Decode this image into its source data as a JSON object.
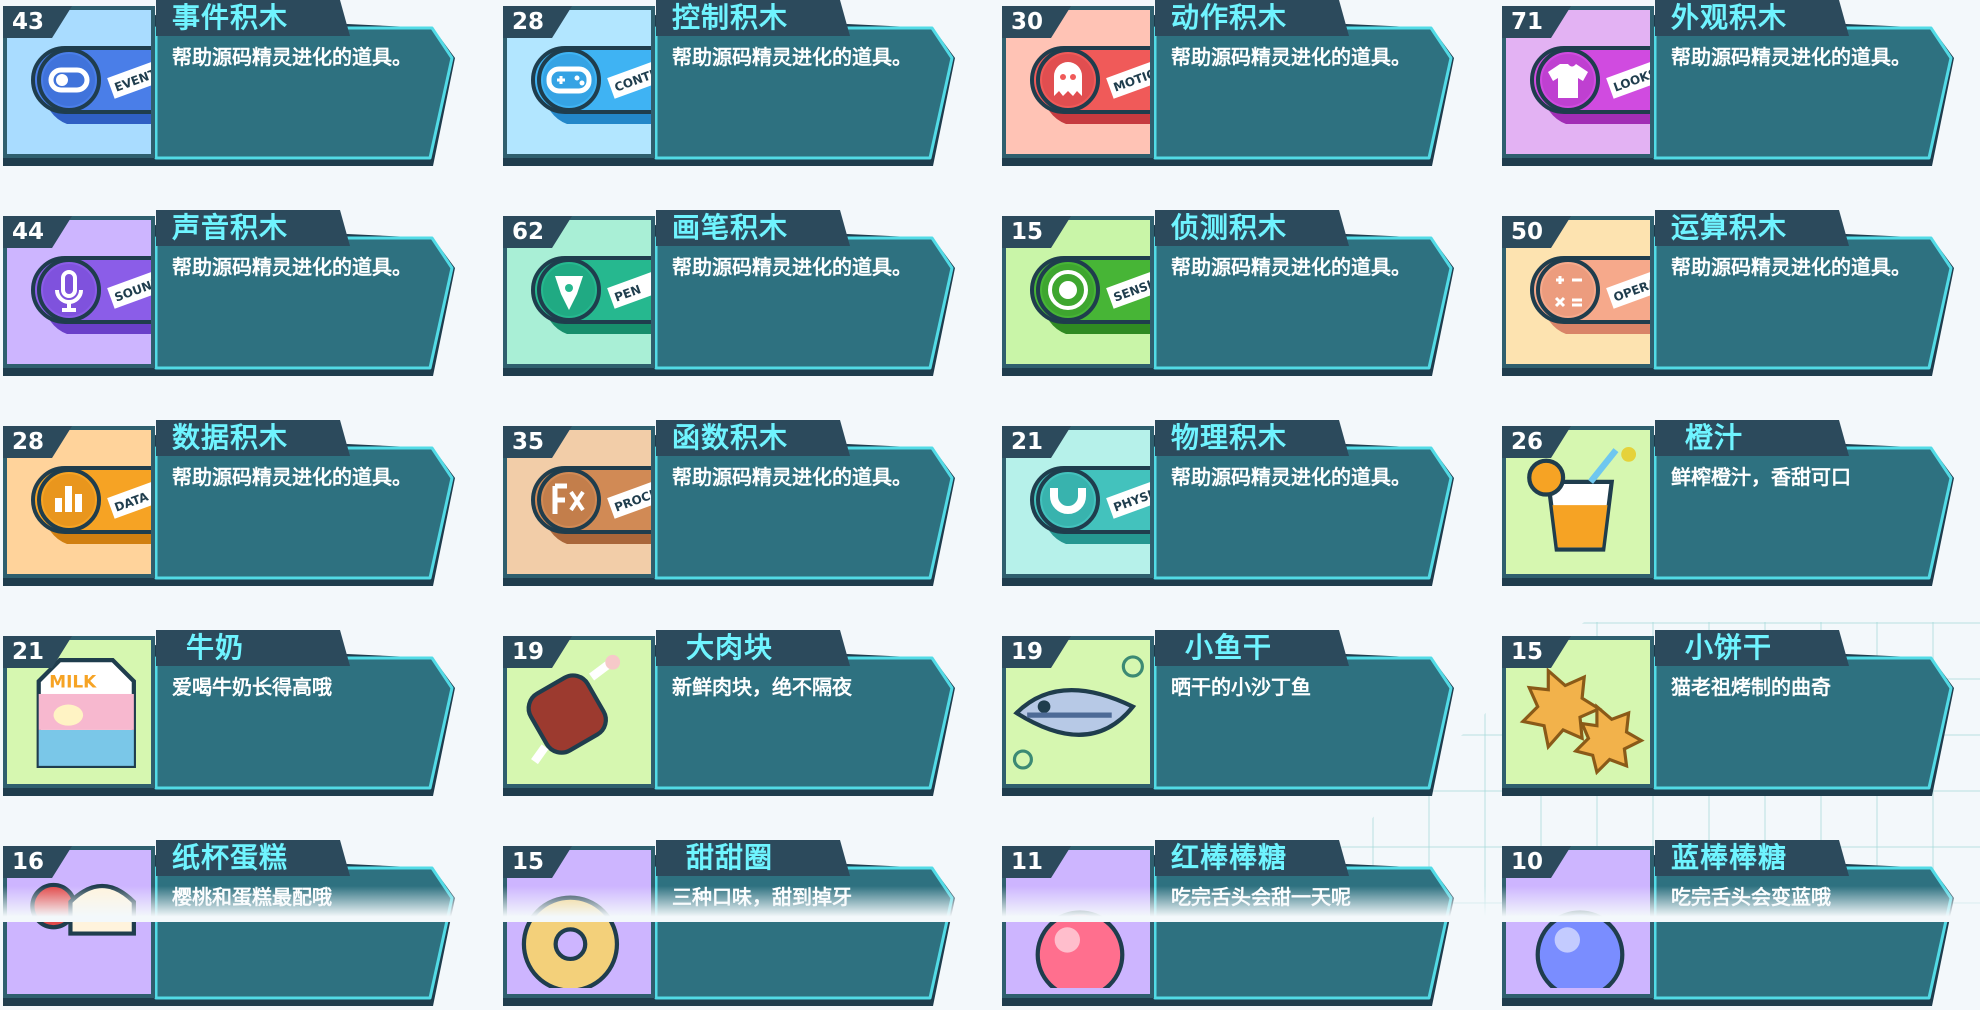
{
  "items": [
    {
      "count": "43",
      "name": "事件积木",
      "desc": "帮助源码精灵进化的道具。",
      "kind": "block",
      "badge": "EVENTS",
      "icon": "toggle-icon",
      "bg": "#a9dcff",
      "color": "#4a7ee8",
      "dark": "#2f5fc4"
    },
    {
      "count": "28",
      "name": "控制积木",
      "desc": "帮助源码精灵进化的道具。",
      "kind": "block",
      "badge": "CONTROL",
      "icon": "gamepad-icon",
      "bg": "#b2e6ff",
      "color": "#3fb3f3",
      "dark": "#2387c9"
    },
    {
      "count": "30",
      "name": "动作积木",
      "desc": "帮助源码精灵进化的道具。",
      "kind": "block",
      "badge": "MOTION",
      "icon": "ghost-icon",
      "bg": "#ffc3b5",
      "color": "#f05a59",
      "dark": "#c63a3f"
    },
    {
      "count": "71",
      "name": "外观积木",
      "desc": "帮助源码精灵进化的道具。",
      "kind": "block",
      "badge": "LOOKS",
      "icon": "shirt-icon",
      "bg": "#e3b2f3",
      "color": "#d04be0",
      "dark": "#a12db5"
    },
    {
      "count": "44",
      "name": "声音积木",
      "desc": "帮助源码精灵进化的道具。",
      "kind": "block",
      "badge": "SOUND",
      "icon": "microphone-icon",
      "bg": "#cdb5ff",
      "color": "#8b5de8",
      "dark": "#6a3fc9"
    },
    {
      "count": "62",
      "name": "画笔积木",
      "desc": "帮助源码精灵进化的道具。",
      "kind": "block",
      "badge": "PEN",
      "icon": "pen-icon",
      "bg": "#a9efd6",
      "color": "#26b88f",
      "dark": "#178e6c"
    },
    {
      "count": "15",
      "name": "侦测积木",
      "desc": "帮助源码精灵进化的道具。",
      "kind": "block",
      "badge": "SENSING",
      "icon": "target-icon",
      "bg": "#c9f5a8",
      "color": "#47b536",
      "dark": "#2f8a22"
    },
    {
      "count": "50",
      "name": "运算积木",
      "desc": "帮助源码精灵进化的道具。",
      "kind": "block",
      "badge": "OPERATOR",
      "icon": "calculator-icon",
      "bg": "#fde3b0",
      "color": "#f6a98b",
      "dark": "#d98468"
    },
    {
      "count": "28",
      "name": "数据积木",
      "desc": "帮助源码精灵进化的道具。",
      "kind": "block",
      "badge": "DATA",
      "icon": "bar-chart-icon",
      "bg": "#ffd39b",
      "color": "#f6a324",
      "dark": "#d17f10"
    },
    {
      "count": "35",
      "name": "函数积木",
      "desc": "帮助源码精灵进化的道具。",
      "kind": "block",
      "badge": "PROCEDURE",
      "icon": "function-icon",
      "bg": "#f2cda8",
      "color": "#d18a55",
      "dark": "#a9663a"
    },
    {
      "count": "21",
      "name": "物理积木",
      "desc": "帮助源码精灵进化的道具。",
      "kind": "block",
      "badge": "PHYSICS",
      "icon": "magnet-icon",
      "bg": "#b6f1ea",
      "color": "#43c2bd",
      "dark": "#259791"
    },
    {
      "count": "26",
      "name": "橙汁",
      "desc": "鲜榨橙汁，香甜可口",
      "kind": "food",
      "icon": "orange-juice-icon",
      "bg": "#d6f7b0",
      "color": "#f6a324",
      "dark": "#d17f10"
    },
    {
      "count": "21",
      "name": "牛奶",
      "desc": "爱喝牛奶长得高哦",
      "kind": "food",
      "icon": "milk-carton-icon",
      "bg": "#d6f7b0",
      "color": "#ffffff",
      "dark": "#7ac7e8"
    },
    {
      "count": "19",
      "name": "大肉块",
      "desc": "新鲜肉块，绝不隔夜",
      "kind": "food",
      "icon": "meat-icon",
      "bg": "#d6f7b0",
      "color": "#9c3a2f",
      "dark": "#6c2219"
    },
    {
      "count": "19",
      "name": "小鱼干",
      "desc": "晒干的小沙丁鱼",
      "kind": "food",
      "icon": "fish-icon",
      "bg": "#d6f7b0",
      "color": "#b7c9e6",
      "dark": "#4d6a96"
    },
    {
      "count": "15",
      "name": "小饼干",
      "desc": "猫老祖烤制的曲奇",
      "kind": "food",
      "icon": "cookie-icon",
      "bg": "#d6f7b0",
      "color": "#f2b24b",
      "dark": "#c77e1b"
    },
    {
      "count": "16",
      "name": "纸杯蛋糕",
      "desc": "樱桃和蛋糕最配哦",
      "kind": "food",
      "icon": "cupcake-icon",
      "bg": "#cdb5ff",
      "color": "#e24a4a",
      "dark": "#9c2a2a"
    },
    {
      "count": "15",
      "name": "甜甜圈",
      "desc": "三种口味，甜到掉牙",
      "kind": "food",
      "icon": "donut-icon",
      "bg": "#cdb5ff",
      "color": "#f3d07a",
      "dark": "#b8842c"
    },
    {
      "count": "11",
      "name": "红棒棒糖",
      "desc": "吃完舌头会甜一天呢",
      "kind": "food",
      "icon": "red-lollipop-icon",
      "bg": "#cdb5ff",
      "color": "#ff6f8e",
      "dark": "#d03c5e"
    },
    {
      "count": "10",
      "name": "蓝棒棒糖",
      "desc": "吃完舌头会变蓝哦",
      "kind": "food",
      "icon": "blue-lollipop-icon",
      "bg": "#cdb5ff",
      "color": "#7a8dff",
      "dark": "#4a5ad6"
    }
  ]
}
